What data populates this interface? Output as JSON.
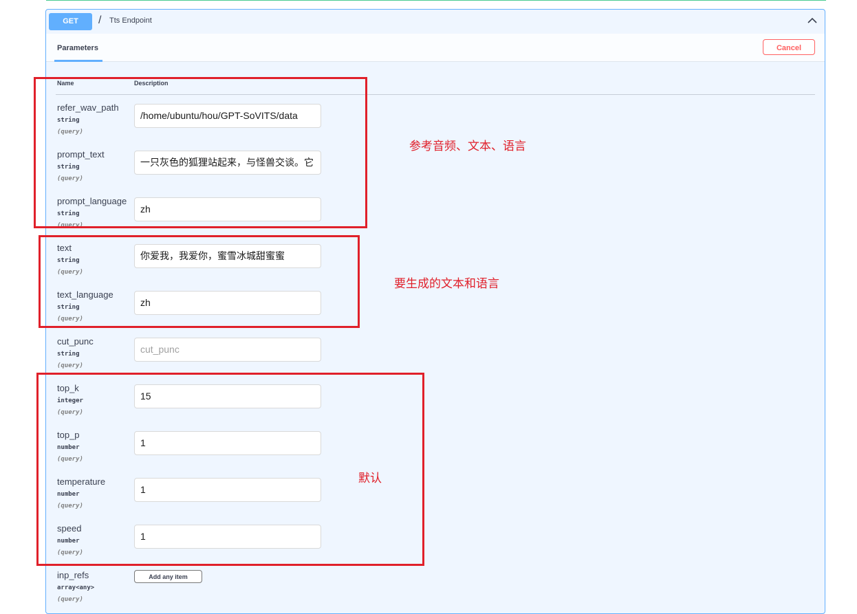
{
  "operation": {
    "method": "GET",
    "path_separator": "/",
    "name": "Tts Endpoint",
    "method_color": "#61affe"
  },
  "section": {
    "tab_label": "Parameters",
    "cancel_label": "Cancel",
    "columns": {
      "name": "Name",
      "description": "Description"
    }
  },
  "parameters": [
    {
      "name": "refer_wav_path",
      "type": "string",
      "in": "(query)",
      "value": "/home/ubuntu/hou/GPT-SoVITS/data",
      "placeholder": ""
    },
    {
      "name": "prompt_text",
      "type": "string",
      "in": "(query)",
      "value": "一只灰色的狐狸站起来，与怪兽交谈。它",
      "placeholder": ""
    },
    {
      "name": "prompt_language",
      "type": "string",
      "in": "(query)",
      "value": "zh",
      "placeholder": ""
    },
    {
      "name": "text",
      "type": "string",
      "in": "(query)",
      "value": "你爱我，我爱你，蜜雪冰城甜蜜蜜",
      "placeholder": ""
    },
    {
      "name": "text_language",
      "type": "string",
      "in": "(query)",
      "value": "zh",
      "placeholder": ""
    },
    {
      "name": "cut_punc",
      "type": "string",
      "in": "(query)",
      "value": "",
      "placeholder": "cut_punc"
    },
    {
      "name": "top_k",
      "type": "integer",
      "in": "(query)",
      "value": "15",
      "placeholder": ""
    },
    {
      "name": "top_p",
      "type": "number",
      "in": "(query)",
      "value": "1",
      "placeholder": ""
    },
    {
      "name": "temperature",
      "type": "number",
      "in": "(query)",
      "value": "1",
      "placeholder": ""
    },
    {
      "name": "speed",
      "type": "number",
      "in": "(query)",
      "value": "1",
      "placeholder": ""
    },
    {
      "name": "inp_refs",
      "type": "array<any>",
      "in": "(query)",
      "button": "Add any item"
    }
  ],
  "annotations": {
    "reference": "参考音频、文本、语言",
    "target": "要生成的文本和语言",
    "default": "默认",
    "color": "#e0202a"
  }
}
